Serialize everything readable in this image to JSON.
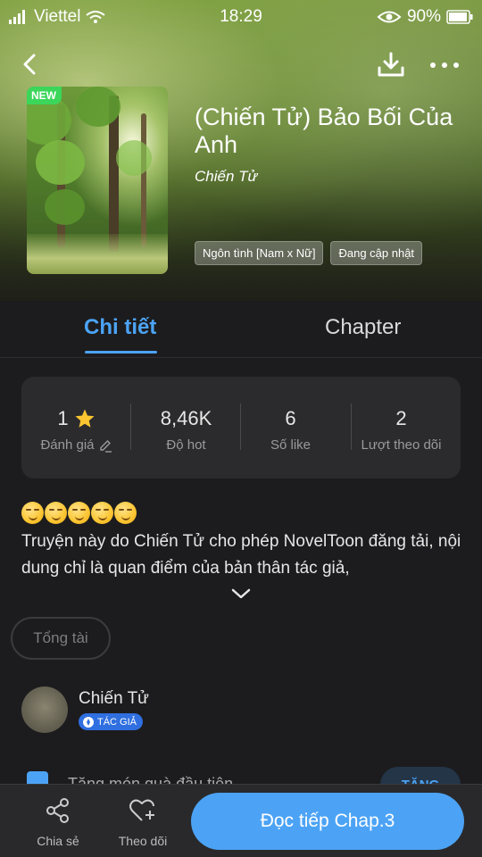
{
  "status_bar": {
    "carrier": "Viettel",
    "time": "18:29",
    "battery": "90%"
  },
  "book": {
    "badge": "NEW",
    "title": "(Chiến Tử) Bảo Bối Của Anh",
    "author": "Chiến Tử",
    "tags": [
      "Ngôn tình [Nam x Nữ]",
      "Đang cập nhật"
    ]
  },
  "tabs": {
    "detail": "Chi tiết",
    "chapter": "Chapter"
  },
  "stats": [
    {
      "value": "1",
      "label": "Đánh giá"
    },
    {
      "value": "8,46K",
      "label": "Độ hot"
    },
    {
      "value": "6",
      "label": "Số like"
    },
    {
      "value": "2",
      "label": "Lượt theo dõi"
    }
  ],
  "description": {
    "emoji_count": 5,
    "text": "Truyện này do Chiến Tử cho phép NovelToon đăng tải, nội dung chỉ là quan điểm của bản thân tác giả,"
  },
  "total_button": "Tổng tài",
  "author_section": {
    "name": "Chiến Tử",
    "badge": "TÁC GIẢ"
  },
  "gift": {
    "text": "Tặng món quà đầu tiên",
    "button": "TẶNG"
  },
  "bottom_bar": {
    "share": "Chia sẻ",
    "follow": "Theo dõi",
    "read": "Đọc tiếp Chap.3"
  },
  "colors": {
    "accent": "#4ca3f5",
    "background": "#1c1c1e",
    "card": "#2b2b2d",
    "star": "#fbc531"
  }
}
